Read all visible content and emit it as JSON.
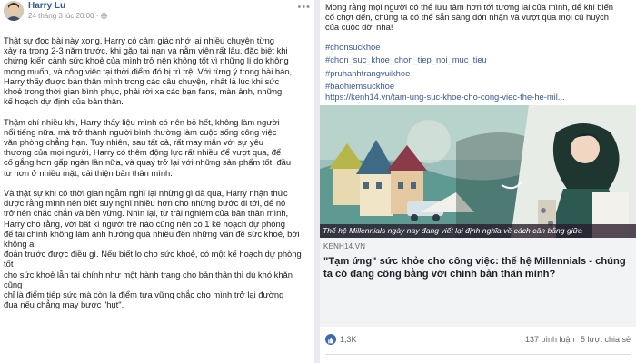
{
  "left_post": {
    "author": "Harry Lu",
    "meta": "24 tháng 3 lúc 20:00 · ",
    "paragraphs": [
      "Thật sự đọc bài này xong, Harry có cảm giác nhớ lại nhiều chuyện từng\nxảy ra trong 2-3 năm trước, khi gặp tai nạn và nằm viện rất lâu, đặc biệt khi\nchứng kiến cảnh sức khoẻ của mình trở nên không tốt vì những lí do không\nmong muốn, và công việc tại thời điểm đó bị trì trệ. Với từng ý trong bài báo,\nHarry thấy được bản thân mình trong các câu chuyện, nhất là lúc khi sức\nkhoẻ trong thời gian bình phục, phải rời xa các bạn fans, màn ảnh, những\nkế hoạch dự định của bản thân.",
      "Thậm chí nhiều khi, Harry thấy liệu mình có nên bỏ hết, không làm người\nnổi tiếng nữa, mà trở thành người bình thường làm cuộc sống công việc\nvăn phòng chẳng hạn. Tuy nhiên, sau tất cả, rất may mắn với sự yêu\nthương của mọi người, Harry có thêm động lực rất nhiều để vượt qua, để\ncố gắng hơn gấp ngàn lần nữa, và quay trở lại với những sản phẩm tốt, đầu\ntư hơn ở nhiều mặt, cải thiện bản thân mình.",
      "Và thật sự khi có thời gian ngẫm nghĩ lại những gì đã qua, Harry nhận thức\nđược rằng mình nên biết suy nghĩ nhiều hơn cho những bước đi tới, để nó\ntrở nên chắc chắn và bền vững. Nhìn lại, từ trải nghiệm của bản thân mình,\nHarry cho rằng, với bất kì người trẻ nào cũng nên có 1 kế hoạch dự phòng\nđể tài chính không làm ảnh hưởng quá nhiều đến những vấn đề sức khoẻ, bởi không ai\nđoán trước được điều gì. Nếu biết lo cho sức khoẻ, có một kế hoạch dự phòng tốt\ncho sức khoẻ lẫn tài chính như một hành trang cho bản thân thì dù khó khăn cũng\nchỉ là điểm tiếp sức mà còn là điểm tựa vững chắc cho mình trở lại đường\nđua nếu chẳng may bước \"hụt\"."
    ]
  },
  "right_post": {
    "intro_text": "Mong rằng mọi người có thể lưu tâm hơn tới tương lai của mình, để khi biến\ncố chợt đến, chúng ta có thể sẵn sàng đón nhận và vượt qua mọi cú huých\ncủa cuộc đời nha!",
    "hashtags": [
      "#chonsuckhoe",
      "#chon_suc_khoe_chon_tiep_noi_muc_tieu",
      "#pruhanhtrangvuikhoe",
      "#baohiemsuckhoe"
    ],
    "link_url": "https://kenh14.vn/tam-ung-suc-khoe-cho-cong-viec-the-he-mil...",
    "image_caption": "Thế hệ Millennials ngày nay đang viết lại định nghĩa về cách cân bằng giữa",
    "link_card": {
      "domain": "KENH14.VN",
      "title": "\"Tạm ứng\" sức khỏe cho công việc: thế hệ Millennials - chúng ta có đang công bằng với chính bản thân mình?"
    },
    "reactions": {
      "like_count": "1,3K",
      "comments": "137 bình luận",
      "shares": "5 lượt chia sẻ"
    }
  },
  "colors": {
    "link_blue": "#385898",
    "divider_gray": "#e9ebee",
    "card_bg": "#f2f3f5",
    "like_blue": "#4267b2"
  },
  "icons": [
    "globe-icon",
    "more-options-icon",
    "like-icon"
  ]
}
